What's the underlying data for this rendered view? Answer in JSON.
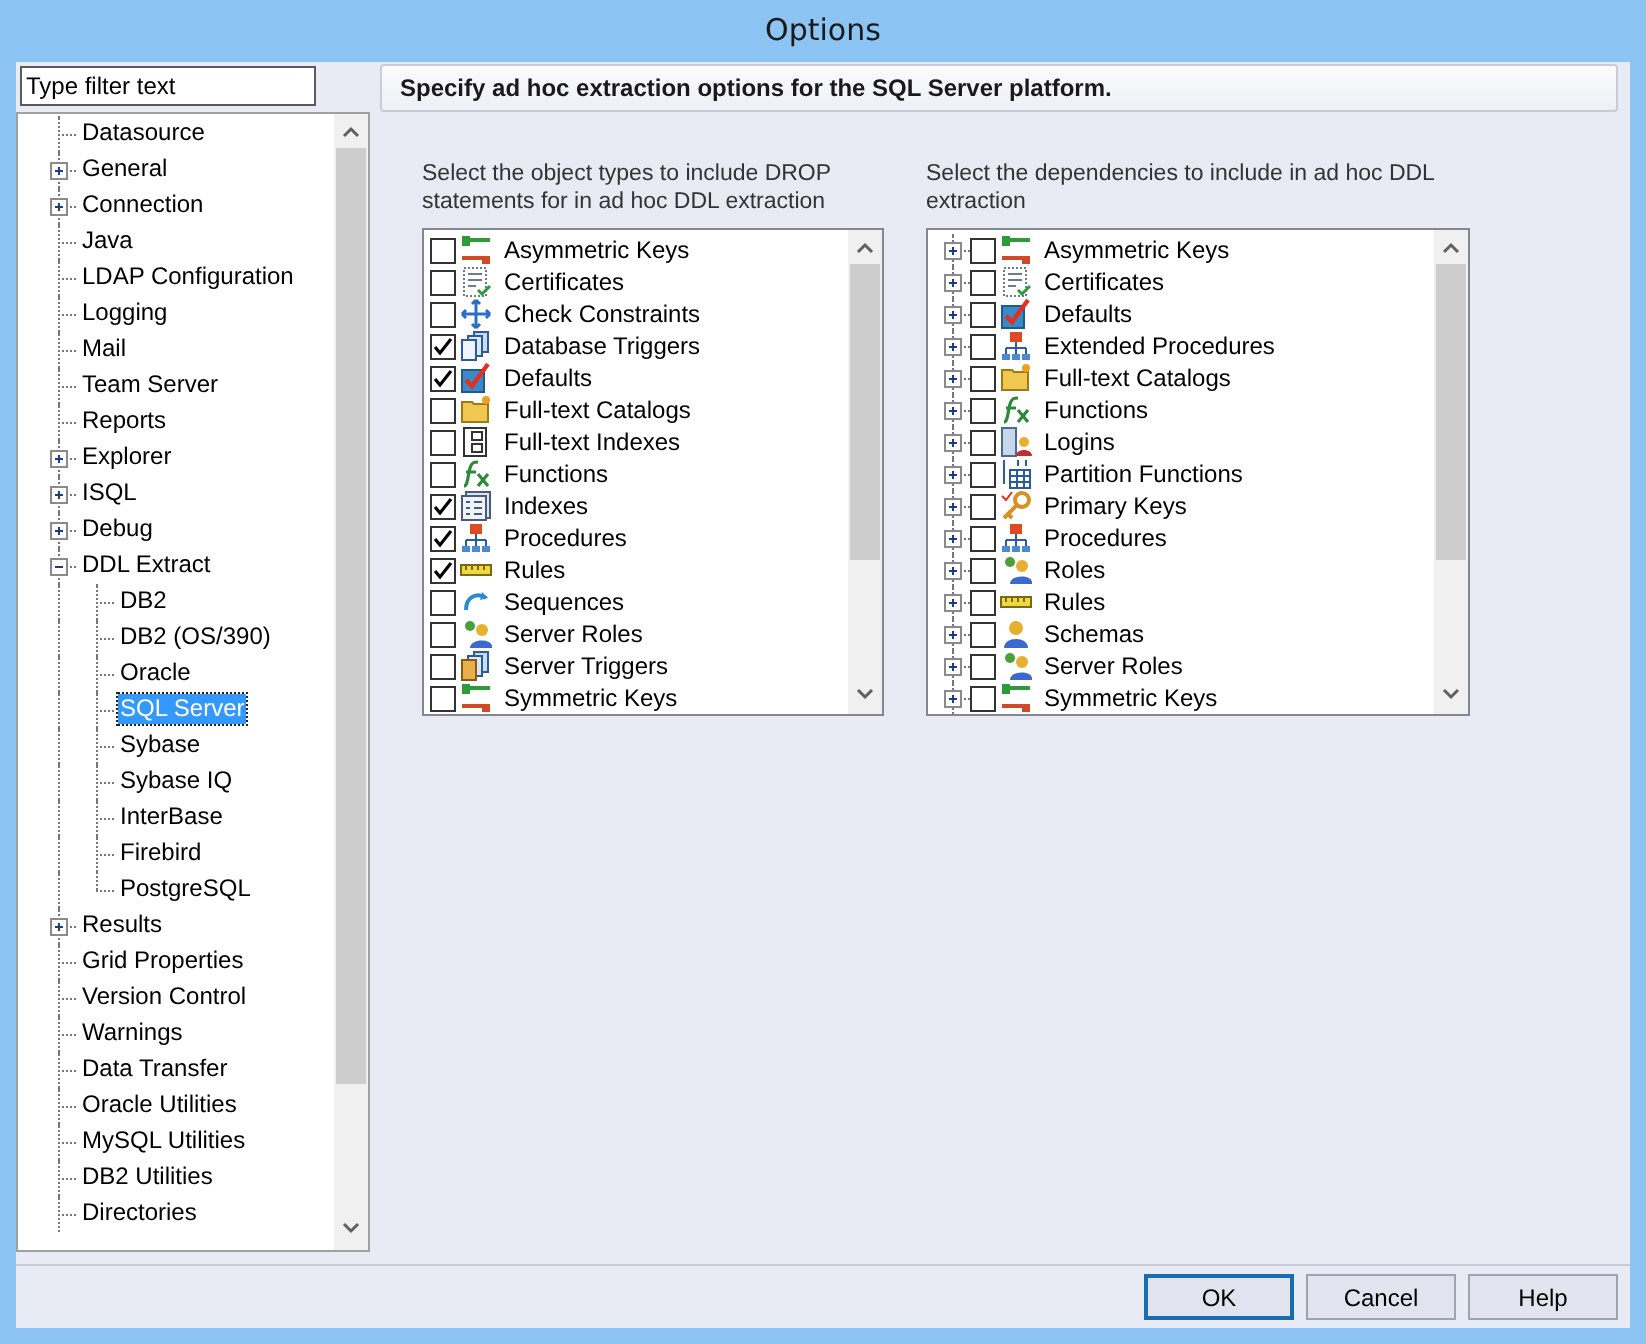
{
  "window": {
    "title": "Options"
  },
  "filter": {
    "placeholder": "Type filter text"
  },
  "tree": [
    {
      "label": "Datasource",
      "selected": false
    },
    {
      "label": "General",
      "selected": false,
      "expanded": false
    },
    {
      "label": "Connection",
      "selected": false,
      "expanded": false
    },
    {
      "label": "Java",
      "selected": false
    },
    {
      "label": "LDAP Configuration",
      "selected": false
    },
    {
      "label": "Logging",
      "selected": false
    },
    {
      "label": "Mail",
      "selected": false
    },
    {
      "label": "Team Server",
      "selected": false
    },
    {
      "label": "Reports",
      "selected": false
    },
    {
      "label": "Explorer",
      "selected": false,
      "expanded": false
    },
    {
      "label": "ISQL",
      "selected": false,
      "expanded": false
    },
    {
      "label": "Debug",
      "selected": false,
      "expanded": false
    },
    {
      "label": "DDL Extract",
      "selected": false,
      "expanded": true,
      "children": [
        {
          "label": "DB2",
          "selected": false
        },
        {
          "label": "DB2 (OS/390)",
          "selected": false
        },
        {
          "label": "Oracle",
          "selected": false
        },
        {
          "label": "SQL Server",
          "selected": true
        },
        {
          "label": "Sybase",
          "selected": false
        },
        {
          "label": "Sybase IQ",
          "selected": false
        },
        {
          "label": "InterBase",
          "selected": false
        },
        {
          "label": "Firebird",
          "selected": false
        },
        {
          "label": "PostgreSQL",
          "selected": false
        }
      ]
    },
    {
      "label": "Results",
      "selected": false,
      "expanded": false
    },
    {
      "label": "Grid Properties",
      "selected": false
    },
    {
      "label": "Version Control",
      "selected": false
    },
    {
      "label": "Warnings",
      "selected": false
    },
    {
      "label": "Data Transfer",
      "selected": false
    },
    {
      "label": "Oracle Utilities",
      "selected": false
    },
    {
      "label": "MySQL Utilities",
      "selected": false
    },
    {
      "label": "DB2 Utilities",
      "selected": false
    },
    {
      "label": "Directories",
      "selected": false
    }
  ],
  "header": "Specify ad hoc extraction options for the SQL Server platform.",
  "drop_list": {
    "label": "Select the object types to include DROP statements for in ad hoc DDL extraction",
    "items": [
      {
        "label": "Asymmetric Keys",
        "checked": false
      },
      {
        "label": "Certificates",
        "checked": false
      },
      {
        "label": "Check Constraints",
        "checked": false
      },
      {
        "label": "Database Triggers",
        "checked": true
      },
      {
        "label": "Defaults",
        "checked": true
      },
      {
        "label": "Full-text Catalogs",
        "checked": false
      },
      {
        "label": "Full-text Indexes",
        "checked": false
      },
      {
        "label": "Functions",
        "checked": false
      },
      {
        "label": "Indexes",
        "checked": true
      },
      {
        "label": "Procedures",
        "checked": true
      },
      {
        "label": "Rules",
        "checked": true
      },
      {
        "label": "Sequences",
        "checked": false
      },
      {
        "label": "Server Roles",
        "checked": false
      },
      {
        "label": "Server Triggers",
        "checked": false
      },
      {
        "label": "Symmetric Keys",
        "checked": false
      }
    ]
  },
  "dependency_list": {
    "label": "Select the dependencies to include in ad hoc DDL extraction",
    "items": [
      {
        "label": "Asymmetric Keys",
        "checked": false,
        "expanded": false
      },
      {
        "label": "Certificates",
        "checked": false,
        "expanded": false
      },
      {
        "label": "Defaults",
        "checked": false,
        "expanded": false
      },
      {
        "label": "Extended Procedures",
        "checked": false,
        "expanded": false
      },
      {
        "label": "Full-text Catalogs",
        "checked": false,
        "expanded": false
      },
      {
        "label": "Functions",
        "checked": false,
        "expanded": false
      },
      {
        "label": "Logins",
        "checked": false,
        "expanded": false
      },
      {
        "label": "Partition Functions",
        "checked": false,
        "expanded": false
      },
      {
        "label": "Primary Keys",
        "checked": false,
        "expanded": false
      },
      {
        "label": "Procedures",
        "checked": false,
        "expanded": false
      },
      {
        "label": "Roles",
        "checked": false,
        "expanded": false
      },
      {
        "label": "Rules",
        "checked": false,
        "expanded": false
      },
      {
        "label": "Schemas",
        "checked": false,
        "expanded": false
      },
      {
        "label": "Server Roles",
        "checked": false,
        "expanded": false
      },
      {
        "label": "Symmetric Keys",
        "checked": false,
        "expanded": false
      }
    ]
  },
  "buttons": [
    {
      "label": "OK",
      "selected": true
    },
    {
      "label": "Cancel",
      "selected": false
    },
    {
      "label": "Help",
      "selected": false
    }
  ]
}
